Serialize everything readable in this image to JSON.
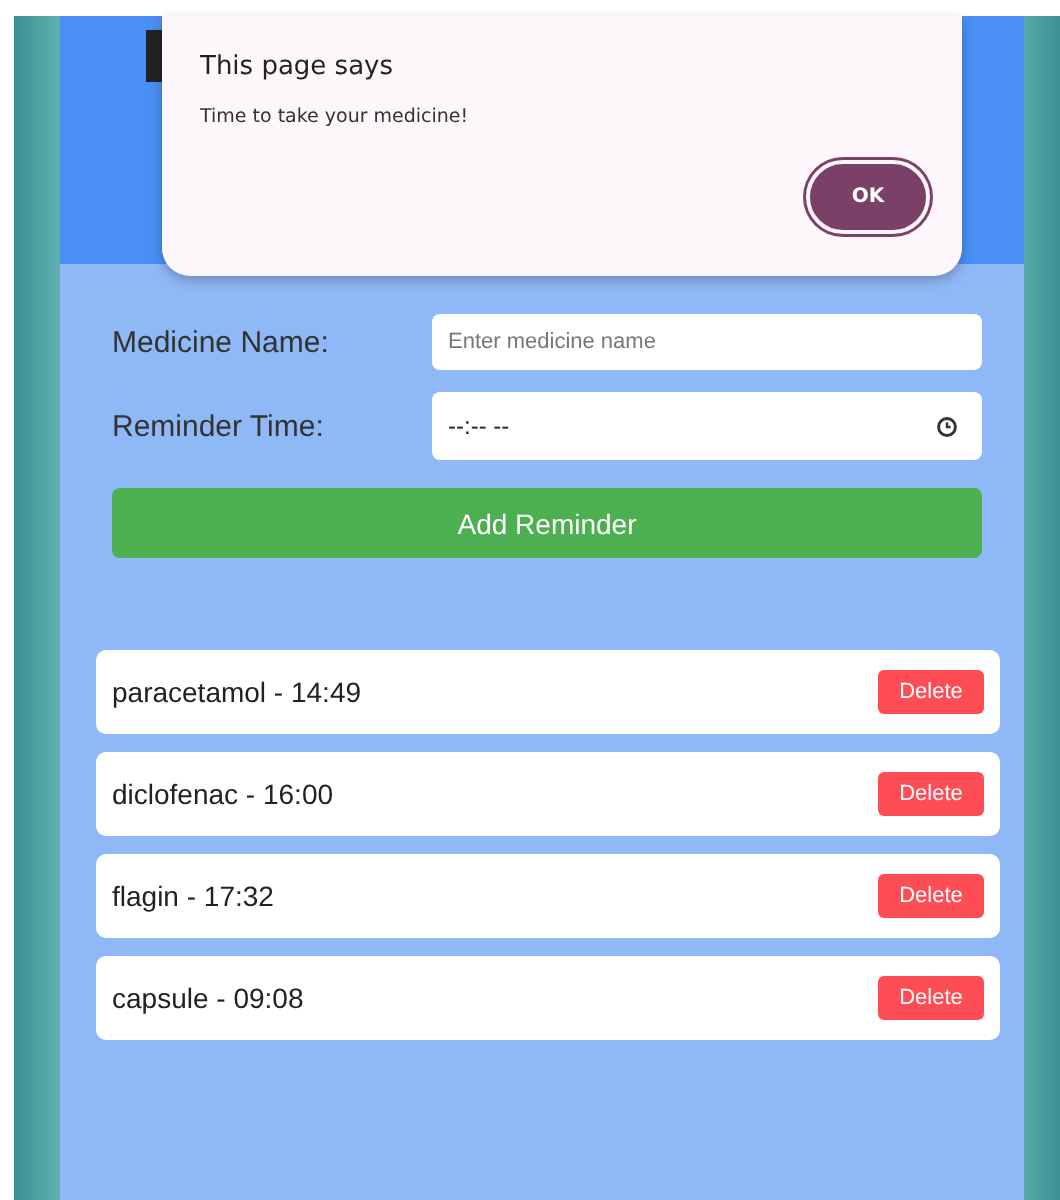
{
  "dialog": {
    "title": "This page says",
    "message": "Time to take your medicine!",
    "button": "OK"
  },
  "form": {
    "fields": [
      {
        "label": "Medicine Name:",
        "placeholder": "Enter medicine name",
        "kind": "text"
      },
      {
        "label": "Reminder Time:",
        "placeholder": "--:-- --",
        "kind": "time"
      }
    ],
    "button": "Add Reminder"
  },
  "reminders": [
    {
      "text": "paracetamol - 14:49",
      "button": "Delete"
    },
    {
      "text": "diclofenac - 16:00",
      "button": "Delete"
    },
    {
      "text": "flagin - 17:32",
      "button": "Delete"
    },
    {
      "text": "capsule - 09:08",
      "button": "Delete"
    }
  ]
}
